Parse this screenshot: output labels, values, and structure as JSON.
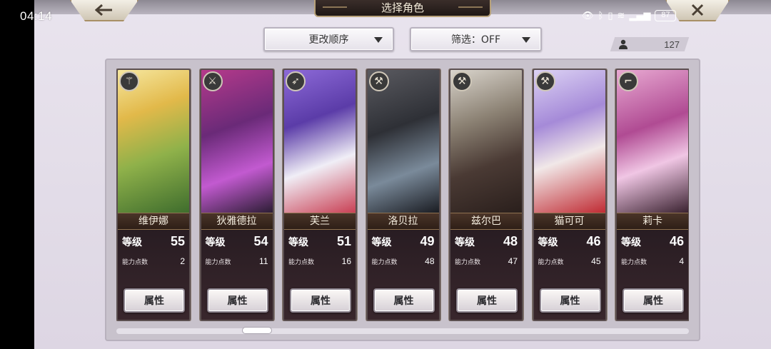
{
  "status_bar": {
    "time": "04:14",
    "battery": "87"
  },
  "header": {
    "title": "选择角色"
  },
  "controls": {
    "sort_label": "更改顺序",
    "filter_label": "筛选：OFF",
    "character_count": "127"
  },
  "card_labels": {
    "level": "等级",
    "points": "能力点数",
    "attr_button": "属性"
  },
  "characters": [
    {
      "name": "维伊娜",
      "level": "55",
      "points": "2",
      "class_icon": "staff-icon"
    },
    {
      "name": "狄雅德拉",
      "level": "54",
      "points": "11",
      "class_icon": "sword-icon"
    },
    {
      "name": "芙兰",
      "level": "51",
      "points": "16",
      "class_icon": "bow-icon"
    },
    {
      "name": "洛贝拉",
      "level": "49",
      "points": "48",
      "class_icon": "axe-icon"
    },
    {
      "name": "兹尔巴",
      "level": "48",
      "points": "47",
      "class_icon": "axe-icon"
    },
    {
      "name": "猫可可",
      "level": "46",
      "points": "45",
      "class_icon": "axe-icon"
    },
    {
      "name": "莉卡",
      "level": "46",
      "points": "4",
      "class_icon": "gun-icon"
    }
  ],
  "colors": {
    "card_frame": "#5b4f50",
    "name_bar": "#3a2820",
    "accent_gold": "#b8a27a"
  }
}
